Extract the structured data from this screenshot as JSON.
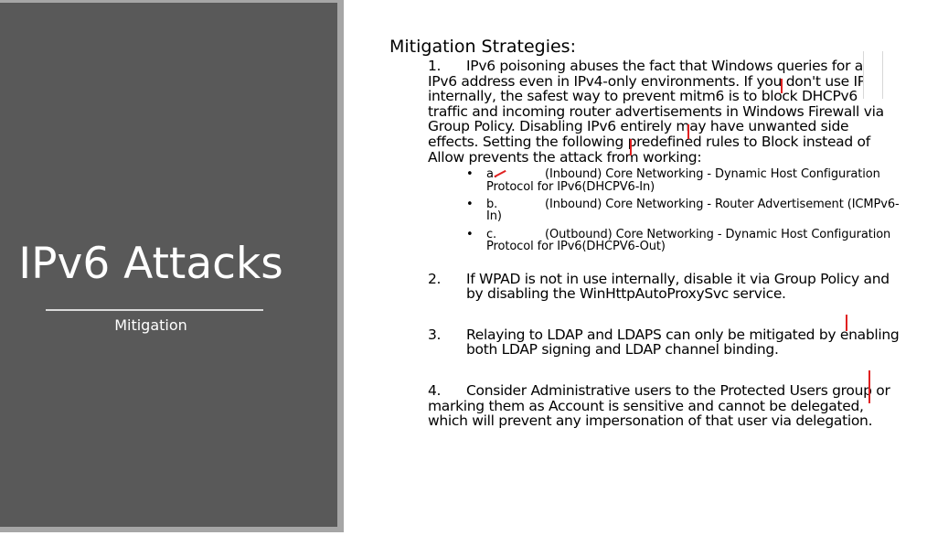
{
  "slide": {
    "title": "IPv6 Attacks",
    "subtitle": "Mitigation"
  },
  "content": {
    "heading": "Mitigation Strategies:",
    "items": [
      {
        "number": "1.",
        "text": "IPv6 poisoning abuses the fact that Windows queries for an IPv6 address even in IPv4-only environments. If you don't use IPv6 internally, the safest way to prevent mitm6 is to block DHCPv6 traffic and incoming router advertisements in Windows Firewall via Group Policy. Disabling IPv6 entirely may have unwanted side effects. Setting the following predefined rules to Block instead of Allow prevents the attack from working:",
        "subitems": [
          {
            "bullet": "•",
            "letter": "a.",
            "text": "(Inbound) Core Networking - Dynamic Host Configuration Protocol for IPv6(DHCPV6-In)"
          },
          {
            "bullet": "•",
            "letter": "b.",
            "text": "(Inbound) Core Networking - Router Advertisement (ICMPv6-In)"
          },
          {
            "bullet": "•",
            "letter": "c.",
            "text": "(Outbound) Core Networking - Dynamic Host Configuration Protocol for IPv6(DHCPV6-Out)"
          }
        ]
      },
      {
        "number": "2.",
        "text": "If WPAD is not in use internally, disable it via Group Policy and by disabling the WinHttpAutoProxySvc service."
      },
      {
        "number": "3.",
        "text": "Relaying to LDAP and LDAPS can only be mitigated by enabling both LDAP signing and LDAP channel binding."
      },
      {
        "number": "4.",
        "text": "Consider Administrative users to the Protected Users group or marking them as Account is sensitive and cannot be delegated, which will prevent any impersonation of that user via delegation."
      }
    ]
  },
  "colors": {
    "panel_dark": "#595959",
    "panel_border": "#a6a6a6",
    "annotation_red": "#e02020"
  }
}
